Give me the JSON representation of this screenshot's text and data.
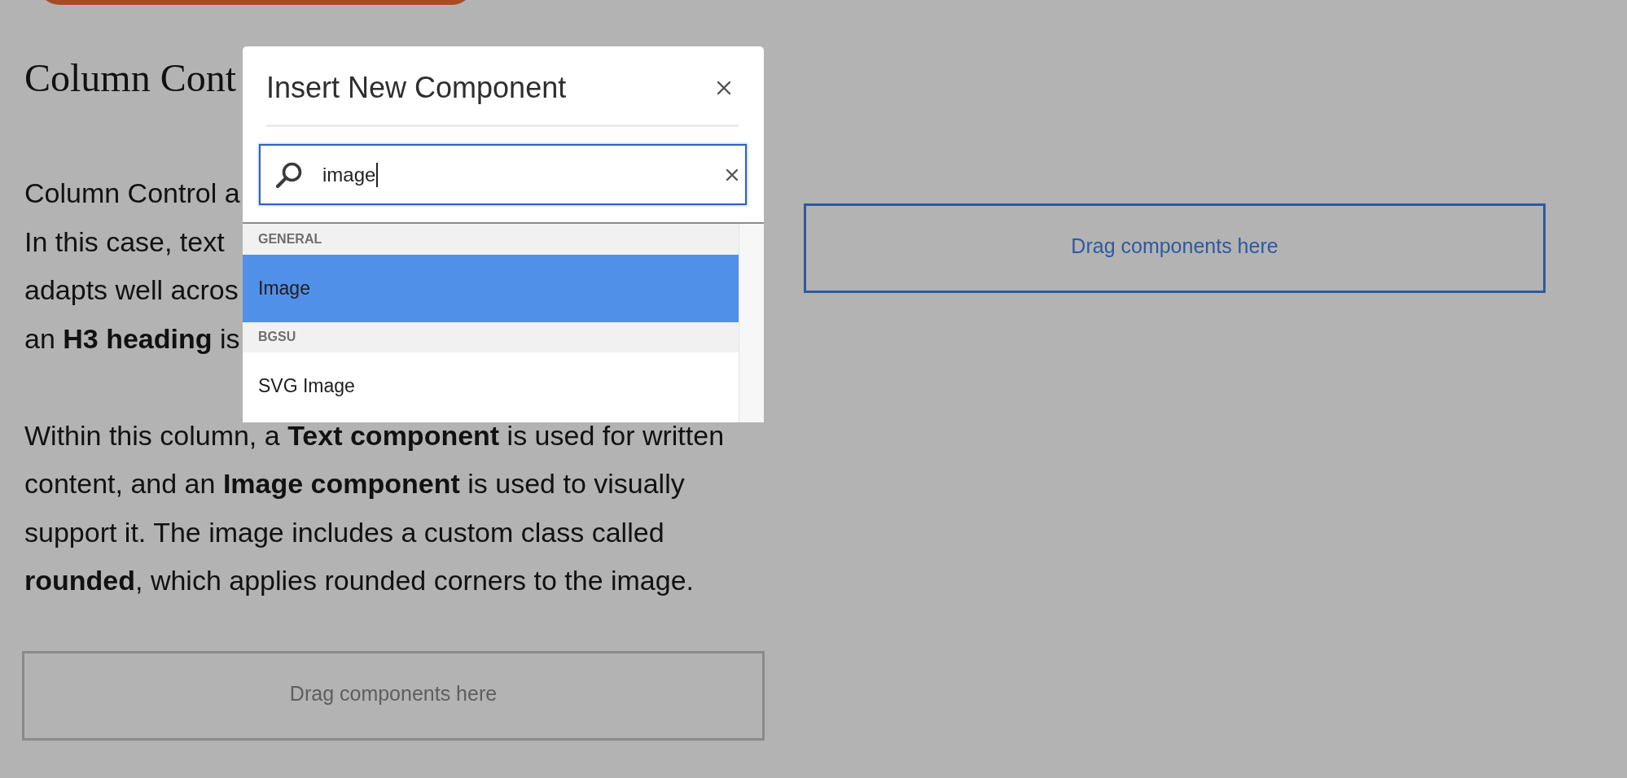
{
  "columns": [
    {
      "heading": "Column Cont",
      "intro_lines": [
        "Column Control a",
        "In this case, text",
        "adapts well acros",
        "an **H3 heading** is"
      ],
      "body": "Within this column, a **Text component** is used for written content, and an **Image component** is used to visually support it. The image includes a custom class called **rounded**, which applies rounded corners to the image.",
      "drop_zone": {
        "label": "Drag components here",
        "selected": false
      }
    },
    {
      "drop_zone": {
        "label": "Drag components here",
        "selected": true
      }
    }
  ],
  "dialog": {
    "title": "Insert New Component",
    "search": {
      "value": "image"
    },
    "groups": [
      {
        "name": "GENERAL",
        "items": [
          {
            "label": "Image",
            "selected": true
          }
        ]
      },
      {
        "name": "BGSU",
        "items": [
          {
            "label": "SVG Image",
            "selected": false
          }
        ]
      }
    ]
  }
}
